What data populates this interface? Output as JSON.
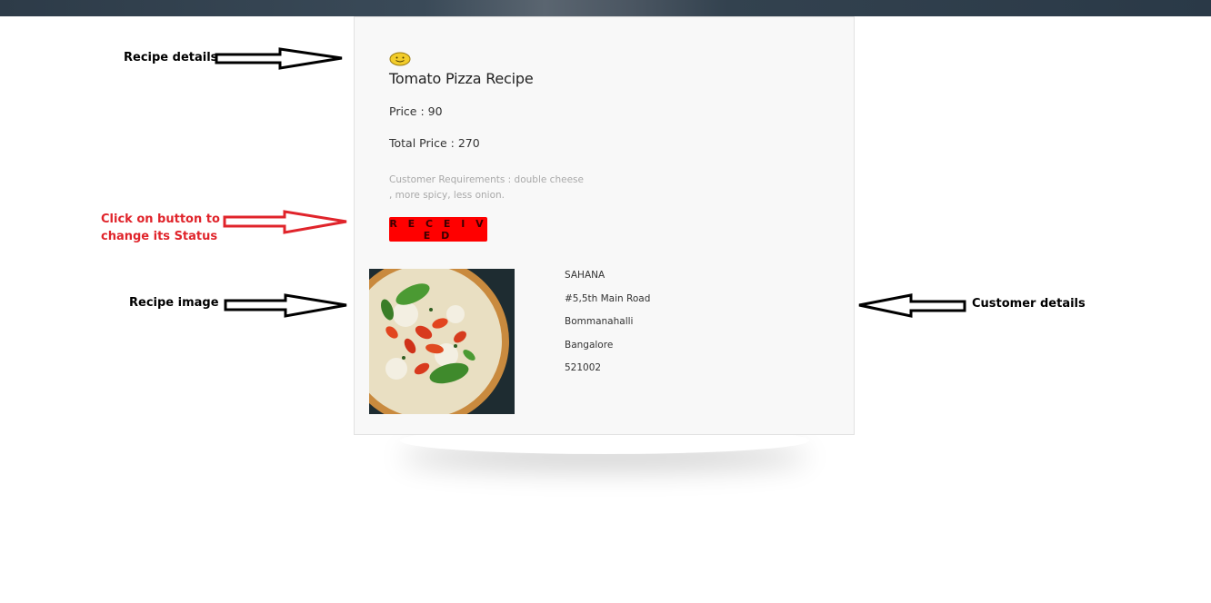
{
  "recipe": {
    "title": "Tomato Pizza Recipe",
    "price": "Price : 90",
    "total_price": "Total Price : 270",
    "requirements": "Customer Requirements : double cheese , more spicy, less onion.",
    "status_button_label": "R E C E I V E D"
  },
  "customer": {
    "name": "SAHANA",
    "address_line1": "#5,5th Main Road",
    "address_line2": "Bommanahalli",
    "city": "Bangalore",
    "pincode": "521002"
  },
  "annotations": {
    "recipe_details": "Recipe details",
    "button_hint_line1": "Click on button to",
    "button_hint_line2": "change its Status",
    "recipe_image": "Recipe image",
    "customer_details": "Customer details"
  },
  "colors": {
    "status_button": "#ff0000",
    "annotation_red": "#e0242b",
    "card_background": "#f8f8f8"
  },
  "icons": {
    "recipe_emoji": "smiley-face-icon"
  }
}
